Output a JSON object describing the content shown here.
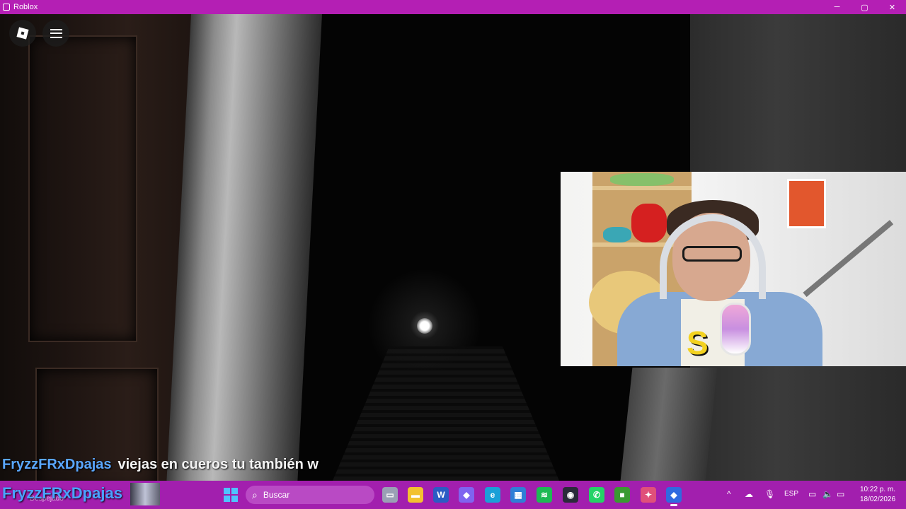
{
  "window": {
    "title": "Roblox",
    "controls": {
      "minimize": "─",
      "maximize": "▢",
      "close": "✕"
    }
  },
  "roblox_overlay": {
    "logo_icon": "roblox-logo-icon",
    "menu_icon": "hamburger-menu-icon"
  },
  "chat": {
    "username": "FryzzFRxDpajas",
    "message": "viejas en cueros tu también w"
  },
  "taskbar": {
    "stream_name": "FryzzFRxDpajas",
    "weather_text": "Despejado",
    "search_placeholder": "Buscar",
    "apps": [
      {
        "name": "task-view",
        "glyph": "▭",
        "color": "#9aa0b5"
      },
      {
        "name": "file-explorer",
        "glyph": "▬",
        "color": "#f2c230"
      },
      {
        "name": "word",
        "glyph": "W",
        "color": "#2b5cc4"
      },
      {
        "name": "copilot",
        "glyph": "◆",
        "color": "#7f64f0"
      },
      {
        "name": "edge",
        "glyph": "e",
        "color": "#1aa0d8"
      },
      {
        "name": "microsoft-store",
        "glyph": "▦",
        "color": "#2f7fd6"
      },
      {
        "name": "spotify",
        "glyph": "≋",
        "color": "#1db954"
      },
      {
        "name": "obs",
        "glyph": "◉",
        "color": "#2a2a3a"
      },
      {
        "name": "whatsapp",
        "glyph": "✆",
        "color": "#25d366"
      },
      {
        "name": "minecraft",
        "glyph": "■",
        "color": "#3a9a32"
      },
      {
        "name": "joystick-app",
        "glyph": "✦",
        "color": "#e0507a"
      },
      {
        "name": "roblox",
        "glyph": "◆",
        "color": "#2f6ae0"
      }
    ],
    "tray": {
      "chevron": "^",
      "language": "ESP",
      "clock_time": "10:22 p. m.",
      "clock_date": "18/02/2026"
    }
  }
}
